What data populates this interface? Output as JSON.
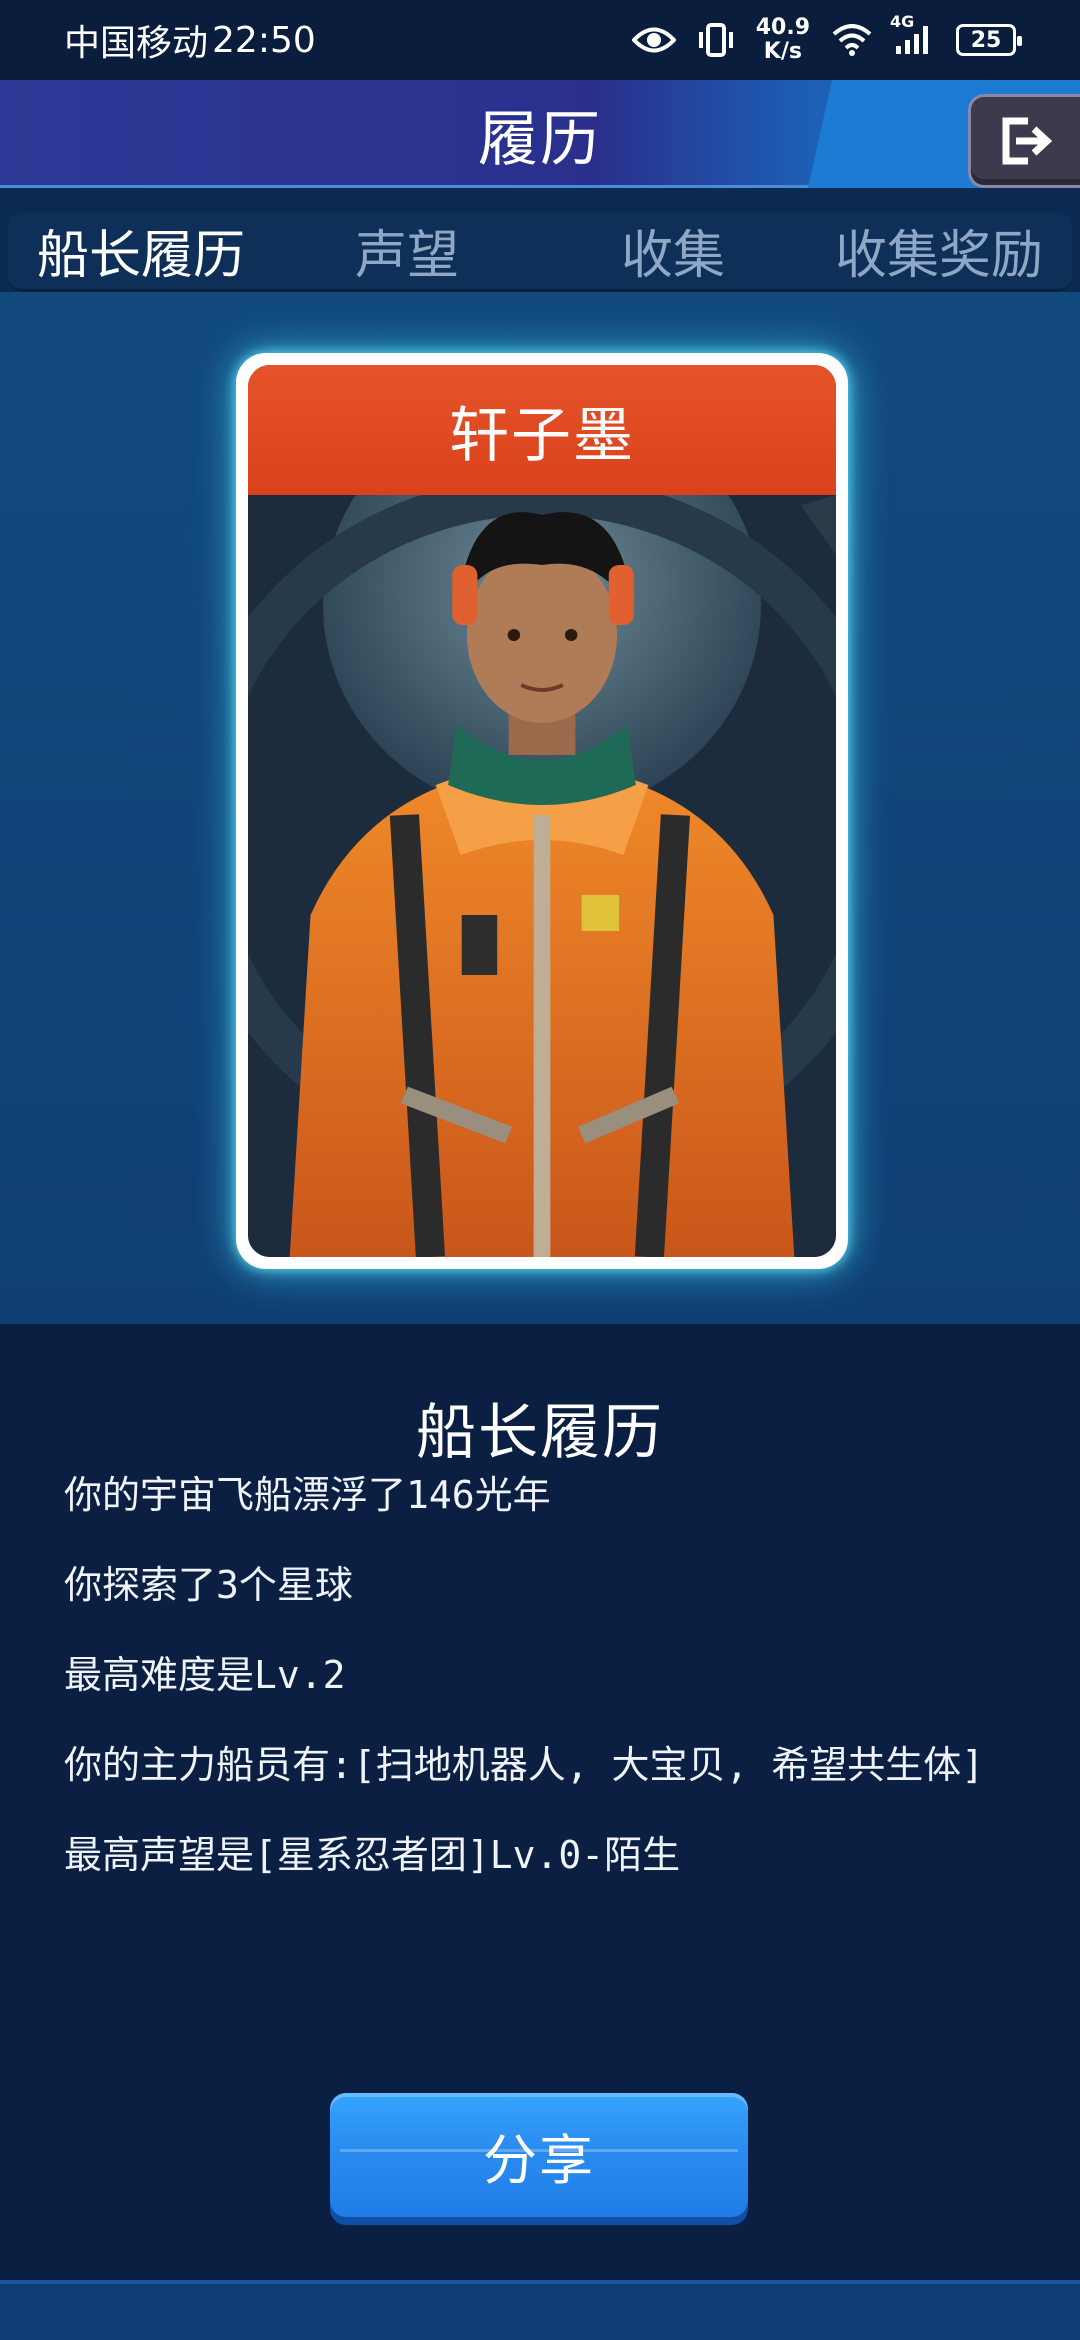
{
  "status_bar": {
    "carrier": "中国移动",
    "time": "22:50",
    "net_speed_value": "40.9",
    "net_speed_unit": "K/s",
    "network_type": "4G",
    "battery": "25",
    "icons": [
      "eye-icon",
      "vibrate-icon",
      "wifi-icon",
      "signal-icon",
      "battery-icon"
    ]
  },
  "header": {
    "title": "履历",
    "exit_icon": "exit-icon"
  },
  "tabs": [
    {
      "label": "船长履历",
      "active": true
    },
    {
      "label": "声望",
      "active": false
    },
    {
      "label": "收集",
      "active": false
    },
    {
      "label": "收集奖励",
      "active": false
    }
  ],
  "card": {
    "name": "轩子墨",
    "image": "captain-portrait"
  },
  "resume": {
    "title": "船长履历",
    "lines": [
      "你的宇宙飞船漂浮了146光年",
      "你探索了3个星球",
      "最高难度是Lv.2",
      "你的主力船员有:[扫地机器人, 大宝贝, 希望共生体]",
      "最高声望是[星系忍者团]Lv.0-陌生"
    ]
  },
  "share_button": {
    "label": "分享"
  },
  "colors": {
    "header_bg": "#2a2f8c",
    "card_name_bg": "#d9421c",
    "card_glow": "#46dcff",
    "panel_bg": "#0a1f42",
    "button_bg": "#2a8cf0"
  }
}
